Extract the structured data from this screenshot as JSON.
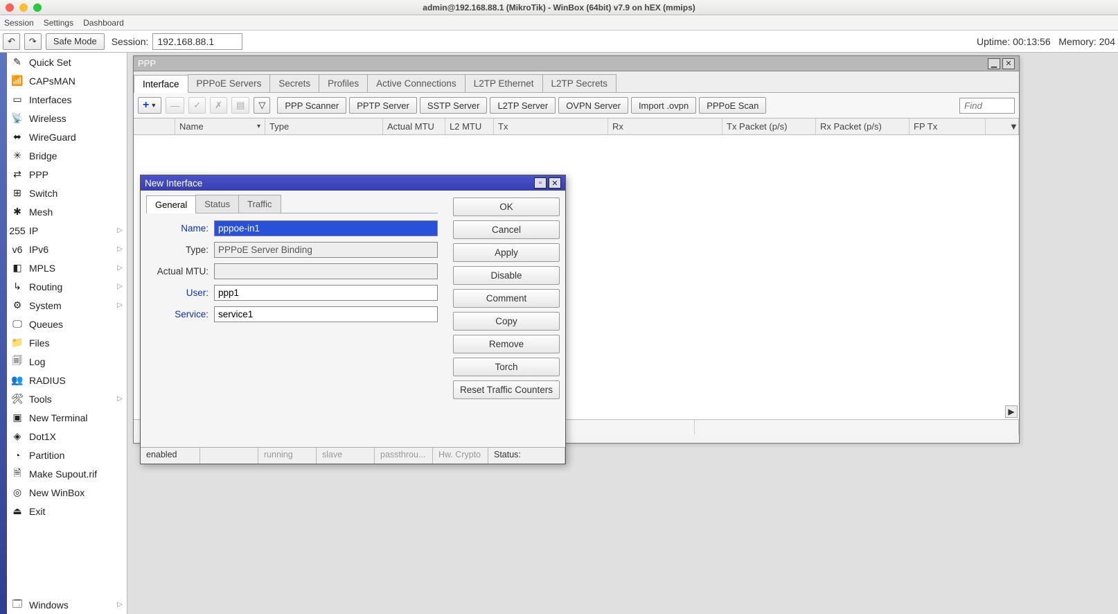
{
  "window_title": "admin@192.168.88.1 (MikroTik) - WinBox (64bit) v7.9 on hEX (mmips)",
  "menubar": {
    "session": "Session",
    "settings": "Settings",
    "dashboard": "Dashboard"
  },
  "toolbar": {
    "undo": "↶",
    "redo": "↷",
    "safe_mode": "Safe Mode",
    "session_label": "Session:",
    "session_value": "192.168.88.1",
    "uptime_label": "Uptime:",
    "uptime_value": "00:13:56",
    "memory_label": "Memory:",
    "memory_value": "204"
  },
  "sidebar": {
    "items": [
      {
        "label": "Quick Set",
        "icon": "✎"
      },
      {
        "label": "CAPsMAN",
        "icon": "📶"
      },
      {
        "label": "Interfaces",
        "icon": "▭"
      },
      {
        "label": "Wireless",
        "icon": "📡"
      },
      {
        "label": "WireGuard",
        "icon": "⬌"
      },
      {
        "label": "Bridge",
        "icon": "✳"
      },
      {
        "label": "PPP",
        "icon": "⇄"
      },
      {
        "label": "Switch",
        "icon": "⊞"
      },
      {
        "label": "Mesh",
        "icon": "✱"
      },
      {
        "label": "IP",
        "icon": "255",
        "arrow": true
      },
      {
        "label": "IPv6",
        "icon": "v6",
        "arrow": true
      },
      {
        "label": "MPLS",
        "icon": "◧",
        "arrow": true
      },
      {
        "label": "Routing",
        "icon": "↳",
        "arrow": true
      },
      {
        "label": "System",
        "icon": "⚙",
        "arrow": true
      },
      {
        "label": "Queues",
        "icon": "🖵"
      },
      {
        "label": "Files",
        "icon": "📁"
      },
      {
        "label": "Log",
        "icon": "🗐"
      },
      {
        "label": "RADIUS",
        "icon": "👥"
      },
      {
        "label": "Tools",
        "icon": "🛠",
        "arrow": true
      },
      {
        "label": "New Terminal",
        "icon": "▣"
      },
      {
        "label": "Dot1X",
        "icon": "◈"
      },
      {
        "label": "Partition",
        "icon": "◔"
      },
      {
        "label": "Make Supout.rif",
        "icon": "🗎"
      },
      {
        "label": "New WinBox",
        "icon": "◎"
      },
      {
        "label": "Exit",
        "icon": "⏏"
      }
    ],
    "bottom": {
      "label": "Windows",
      "icon": "🗔",
      "arrow": true
    }
  },
  "ppp_window": {
    "title": "PPP",
    "tabs": [
      "Interface",
      "PPPoE Servers",
      "Secrets",
      "Profiles",
      "Active Connections",
      "L2TP Ethernet",
      "L2TP Secrets"
    ],
    "active_tab": 0,
    "toolbar_buttons": [
      "PPP Scanner",
      "PPTP Server",
      "SSTP Server",
      "L2TP Server",
      "OVPN Server",
      "Import .ovpn",
      "PPPoE Scan"
    ],
    "find_placeholder": "Find",
    "columns": [
      "",
      "Name",
      "Type",
      "Actual MTU",
      "L2 MTU",
      "Tx",
      "Rx",
      "Tx Packet (p/s)",
      "Rx Packet (p/s)",
      "FP Tx"
    ]
  },
  "new_iface_dialog": {
    "title": "New Interface",
    "tabs": [
      "General",
      "Status",
      "Traffic"
    ],
    "active_tab": 0,
    "fields": {
      "name_label": "Name:",
      "name_value": "pppoe-in1",
      "type_label": "Type:",
      "type_value": "PPPoE Server Binding",
      "mtu_label": "Actual MTU:",
      "mtu_value": "",
      "user_label": "User:",
      "user_value": "ppp1",
      "service_label": "Service:",
      "service_value": "service1"
    },
    "buttons": [
      "OK",
      "Cancel",
      "Apply",
      "Disable",
      "Comment",
      "Copy",
      "Remove",
      "Torch",
      "Reset Traffic Counters"
    ],
    "status": {
      "enabled": "enabled",
      "running": "running",
      "slave": "slave",
      "passthrough": "passthrou...",
      "hw": "Hw. Crypto",
      "status_label": "Status:"
    }
  }
}
